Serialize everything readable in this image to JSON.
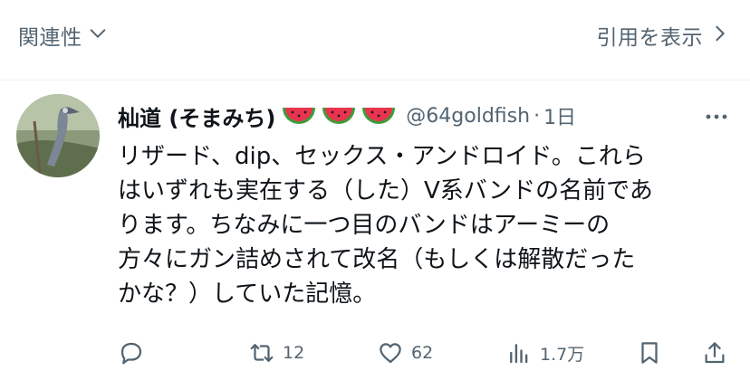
{
  "top_bar": {
    "related_label": "関連性",
    "quotes_label": "引用を表示"
  },
  "tweet": {
    "display_name": "杣道 (そまみち)",
    "name_emojis": [
      "watermelon-emoji",
      "watermelon-emoji",
      "watermelon-emoji"
    ],
    "handle": "@64goldfish",
    "separator": "·",
    "time": "1日",
    "text_lines": [
      "リザード、dip、セックス・アンドロイド。これら",
      "はいずれも実在する（した）V系バンドの名前であ",
      "ります。ちなみに一つ目のバンドはアーミーの",
      "方々にガン詰めされて改名（もしくは解散だった",
      "かな？）していた記憶。"
    ]
  },
  "actions": {
    "reply_count": "",
    "retweet_count": "12",
    "like_count": "62",
    "views_count": "1.7万"
  },
  "icons": {
    "related": "chevron-down-icon",
    "quotes": "chevron-right-icon",
    "more": "more-icon",
    "reply": "reply-icon",
    "retweet": "retweet-icon",
    "like": "heart-icon",
    "views": "views-icon",
    "bookmark": "bookmark-icon",
    "share": "share-icon"
  },
  "colors": {
    "text_primary": "#0f1419",
    "text_secondary": "#536471",
    "divider": "#eff3f4",
    "watermelon_red": "#e8344e",
    "watermelon_green": "#3f9b3a"
  }
}
